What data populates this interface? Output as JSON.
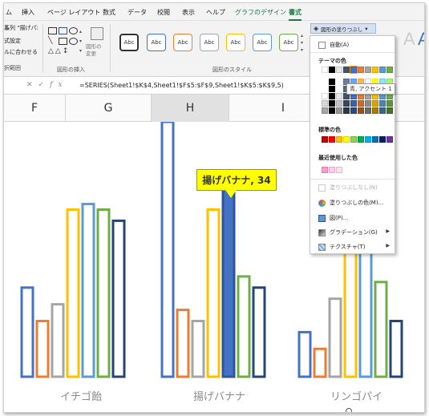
{
  "tabs": [
    "ム",
    "挿入",
    "ページ レイアウト",
    "数式",
    "データ",
    "校閲",
    "表示",
    "ヘルプ",
    "グラフのデザイン",
    "書式"
  ],
  "ribbon": {
    "left_items": [
      "ル",
      "系列 \"揚げパ:",
      "式設定",
      "ルに合わせる",
      "択範囲"
    ],
    "insert_shapes_label": "図形の挿入",
    "change_shape": "図形の変更",
    "shape_style_label": "図形のスタイル",
    "style_sample": "Abc",
    "fill_button": "図形の塗りつぶし"
  },
  "formula_bar": {
    "formula": "=SERIES(Sheet1!$K$4,Sheet1!$F$5:$F$9,Sheet1!$K$5:$K$9,5)"
  },
  "columns": [
    "F",
    "G",
    "H",
    "I"
  ],
  "chart_data": {
    "type": "bar",
    "categories": [
      "イチゴ飴",
      "揚げバナナ",
      "リンゴパイ"
    ],
    "series_colors": [
      "#4472c4",
      "#ed7d31",
      "#a5a5a5",
      "#ffc000",
      "#5b9bd5",
      "#70ad47",
      "#264478"
    ],
    "values": [
      [
        16,
        10,
        13,
        30,
        31,
        30,
        28
      ],
      [
        58,
        12,
        10,
        30,
        34,
        18,
        16
      ],
      [
        8,
        5,
        14,
        26,
        30,
        17,
        10
      ]
    ],
    "highlight": {
      "category_index": 1,
      "series_index": 4
    },
    "callout": "揚げバナナ, 34"
  },
  "menu": {
    "auto": "自動(A)",
    "theme_colors": "テーマの色",
    "tooltip": "青, アクセント 1",
    "standard_colors": "標準の色",
    "recent_colors": "最近使用した色",
    "no_fill": "塗りつぶしなし(N)",
    "more_colors": "塗りつぶしの色(M)...",
    "picture": "図(P)...",
    "gradient": "グラデーション(G)",
    "texture": "テクスチャ(T)",
    "theme_palette": [
      "#ffffff",
      "#000000",
      "#e7e6e6",
      "#44546a",
      "#4472c4",
      "#ed7d31",
      "#a5a5a5",
      "#ffc000",
      "#5b9bd5",
      "#70ad47"
    ],
    "standard_palette": [
      "#c00000",
      "#ff0000",
      "#ffc000",
      "#ffff00",
      "#92d050",
      "#00b050",
      "#00b0f0",
      "#0070c0",
      "#002060",
      "#7030a0"
    ],
    "recent_palette": [
      "#ff99cc",
      "#ffccee",
      "#ffe0f0"
    ]
  }
}
